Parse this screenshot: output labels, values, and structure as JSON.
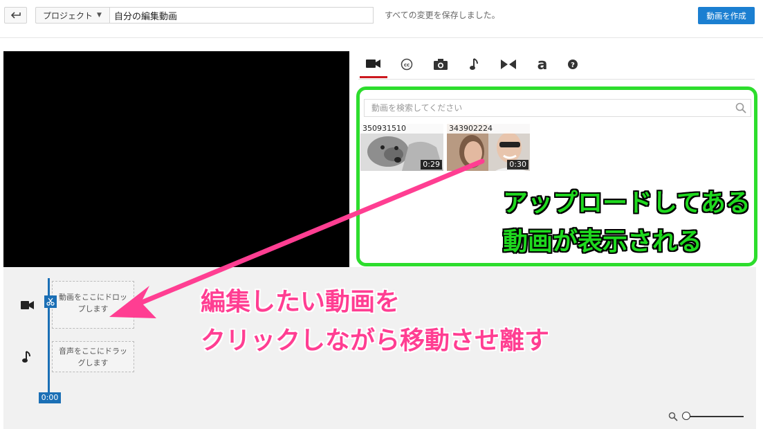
{
  "header": {
    "project_label": "プロジェクト",
    "title_value": "自分の編集動画",
    "save_status": "すべての変更を保存しました。",
    "create_button": "動画を作成"
  },
  "tabs": [
    {
      "icon": "video-camera-icon",
      "active": true
    },
    {
      "icon": "closed-caption-icon",
      "active": false
    },
    {
      "icon": "camera-icon",
      "active": false
    },
    {
      "icon": "music-note-icon",
      "active": false
    },
    {
      "icon": "transitions-icon",
      "active": false
    },
    {
      "icon": "text-icon",
      "active": false
    },
    {
      "icon": "help-icon",
      "active": false
    }
  ],
  "media": {
    "search_placeholder": "動画を検索してください",
    "videos": [
      {
        "id": "350931510",
        "duration": "0:29"
      },
      {
        "id": "343902224",
        "duration": "0:30"
      }
    ]
  },
  "annotations": {
    "green_line1": "アップロードしてある",
    "green_line2": "動画が表示される",
    "pink_line1": "編集したい動画を",
    "pink_line2": "クリックしながら移動させ離す"
  },
  "timeline": {
    "video_drop_line1": "動画をここにドロッ",
    "video_drop_line2": "プします",
    "audio_drop_line1": "音声をここにドラッ",
    "audio_drop_line2": "グします",
    "playhead_time": "0:00"
  },
  "colors": {
    "accent_blue": "#1b7fd1",
    "tab_active": "#cc181e",
    "callout_green": "#2ddd2d",
    "callout_pink": "#ff3e92"
  }
}
